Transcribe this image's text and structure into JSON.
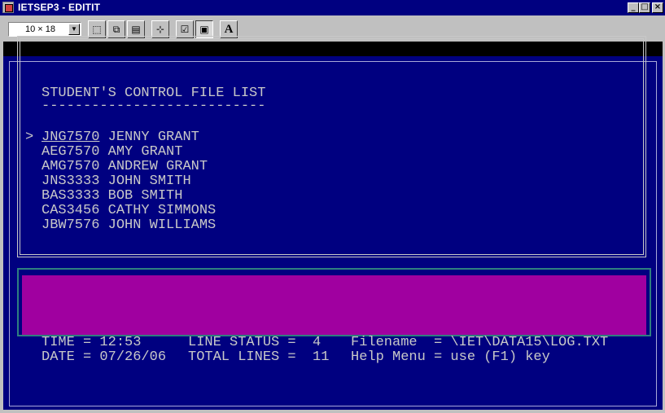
{
  "window": {
    "title": "IETSEP3 - EDITIT",
    "minimize_glyph": "_",
    "maximize_glyph": "□",
    "close_glyph": "×"
  },
  "toolbar": {
    "font_size_value": "10 × 18",
    "dropdown_glyph": "▼",
    "mark_glyph": "⬚",
    "copy_glyph": "⧉",
    "paste_glyph": "▤",
    "fullscreen_glyph": "⊹",
    "properties_glyph": "☑",
    "background_glyph": "▣",
    "font_glyph": "A"
  },
  "list": {
    "title": "STUDENT'S CONTROL FILE LIST",
    "underline": "---------------------------",
    "pointer": ">",
    "students": [
      {
        "id": "JNG7570",
        "name": "JENNY GRANT",
        "current": true
      },
      {
        "id": "AEG7570",
        "name": "AMY GRANT",
        "current": false
      },
      {
        "id": "AMG7570",
        "name": "ANDREW GRANT",
        "current": false
      },
      {
        "id": "JNS3333",
        "name": "JOHN SMITH",
        "current": false
      },
      {
        "id": "BAS3333",
        "name": "BOB SMITH",
        "current": false
      },
      {
        "id": "CAS3456",
        "name": "CATHY SIMMONS",
        "current": false
      },
      {
        "id": "JBW7576",
        "name": "JOHN WILLIAMS",
        "current": false
      }
    ]
  },
  "status": {
    "time": "TIME = 12:53",
    "date": "DATE = 07/26/06",
    "line_status": "LINE STATUS =  4",
    "total_lines": "TOTAL LINES =  11",
    "filename": "Filename  = \\IET\\DATA15\\LOG.TXT",
    "help_menu": "Help Menu = use (F1) key"
  },
  "colors": {
    "console_background": "#000080",
    "console_text": "#c8c8c8",
    "status_background": "#a000a0",
    "title_bar": "#000080"
  }
}
